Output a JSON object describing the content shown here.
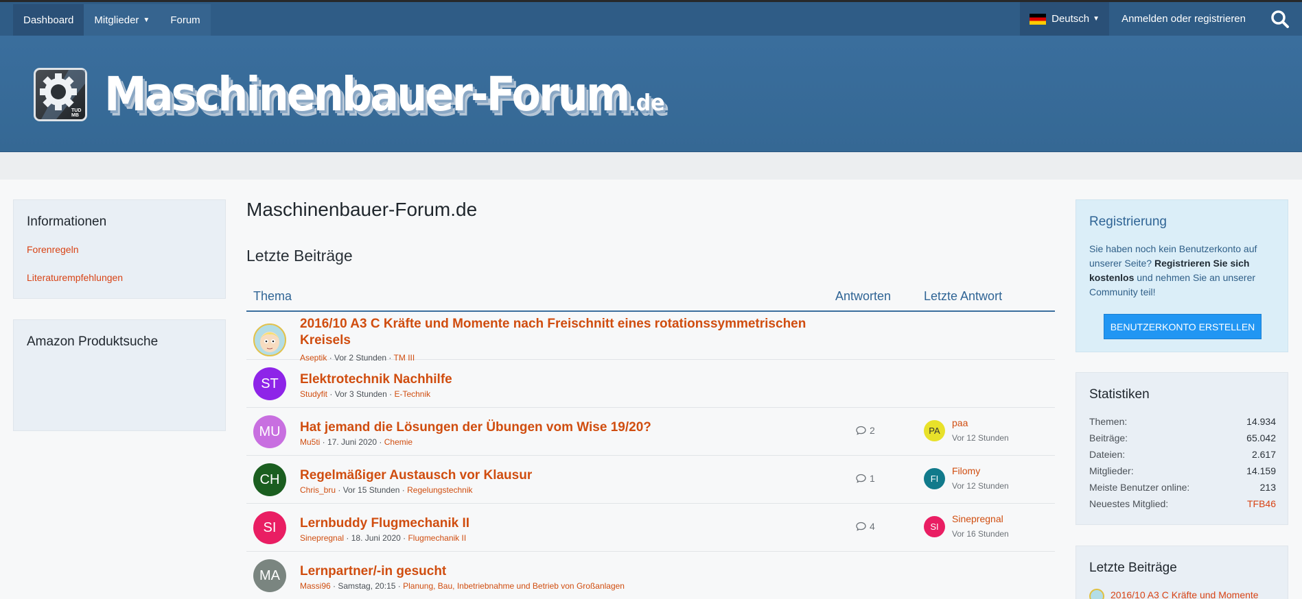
{
  "nav": {
    "items": [
      {
        "label": "Dashboard",
        "active": true
      },
      {
        "label": "Mitglieder",
        "has_dropdown": true
      },
      {
        "label": "Forum"
      }
    ],
    "language": "Deutsch",
    "login": "Anmelden oder registrieren",
    "search_icon": "search-icon"
  },
  "banner": {
    "logo_name": "Maschinenbauer-Forum",
    "logo_tld": ".de",
    "logo_badge": "TUD MB"
  },
  "left": {
    "info": {
      "title": "Informationen",
      "links": [
        "Forenregeln",
        "Literaturempfehlungen"
      ]
    },
    "amazon": {
      "title": "Amazon Produktsuche"
    }
  },
  "main": {
    "page_title": "Maschinenbauer-Forum.de",
    "section_title": "Letzte Beiträge",
    "columns": {
      "topic": "Thema",
      "replies": "Antworten",
      "last": "Letzte Antwort"
    },
    "rows": [
      {
        "avatar": "",
        "avatar_color": "#b3dde6",
        "title": "2016/10 A3 C Kräfte und Momente nach Freischnitt eines rotationssymmetrischen Kreisels",
        "author": "Aseptik",
        "time": "Vor 2 Stunden",
        "forum": "TM III"
      },
      {
        "avatar": "ST",
        "avatar_color": "#8e24e8",
        "title": "Elektrotechnik Nachhilfe",
        "author": "Studyfit",
        "time": "Vor 3 Stunden",
        "forum": "E-Technik"
      },
      {
        "avatar": "MU",
        "avatar_color": "#c86fe0",
        "title": "Hat jemand die Lösungen der Übungen vom Wise 19/20?",
        "author": "Mu5ti",
        "time": "17. Juni 2020",
        "forum": "Chemie",
        "replies": "2",
        "last_avatar": "PA",
        "last_color": "#e8e12a",
        "last_text_color": "#333333",
        "last_user": "paa",
        "last_time": "Vor 12 Stunden"
      },
      {
        "avatar": "CH",
        "avatar_color": "#1b5e20",
        "title": "Regelmäßiger Austausch vor Klausur",
        "author": "Chris_bru",
        "time": "Vor 15 Stunden",
        "forum": "Regelungstechnik",
        "replies": "1",
        "last_avatar": "FI",
        "last_color": "#117a8b",
        "last_text_color": "#ffffff",
        "last_user": "Filomy",
        "last_time": "Vor 12 Stunden"
      },
      {
        "avatar": "SI",
        "avatar_color": "#e91e63",
        "title": "Lernbuddy Flugmechanik II",
        "author": "Sinepregnal",
        "time": "18. Juni 2020",
        "forum": "Flugmechanik II",
        "replies": "4",
        "last_avatar": "SI",
        "last_color": "#e91e63",
        "last_text_color": "#ffffff",
        "last_user": "Sinepregnal",
        "last_time": "Vor 16 Stunden"
      },
      {
        "avatar": "MA",
        "avatar_color": "#7a8580",
        "title": "Lernpartner/-in gesucht",
        "author": "Massi96",
        "time": "Samstag, 20:15",
        "forum": "Planung, Bau, Inbetriebnahme und Betrieb von Großanlagen"
      }
    ]
  },
  "right": {
    "register": {
      "title": "Registrierung",
      "text_before": "Sie haben noch kein Benutzerkonto auf unserer Seite?",
      "text_bold": "Registrieren Sie sich kostenlos",
      "text_after": "und nehmen Sie an unserer Community teil!",
      "button": "BENUTZERKONTO ERSTELLEN"
    },
    "stats": {
      "title": "Statistiken",
      "rows": [
        {
          "label": "Themen:",
          "value": "14.934"
        },
        {
          "label": "Beiträge:",
          "value": "65.042"
        },
        {
          "label": "Dateien:",
          "value": "2.617"
        },
        {
          "label": "Mitglieder:",
          "value": "14.159"
        },
        {
          "label": "Meiste Benutzer online:",
          "value": "213"
        },
        {
          "label": "Neuestes Mitglied:",
          "value": "TFB46",
          "link": true
        }
      ]
    },
    "latest": {
      "title": "Letzte Beiträge",
      "first_item": "2016/10 A3 C Kräfte und Momente"
    }
  }
}
